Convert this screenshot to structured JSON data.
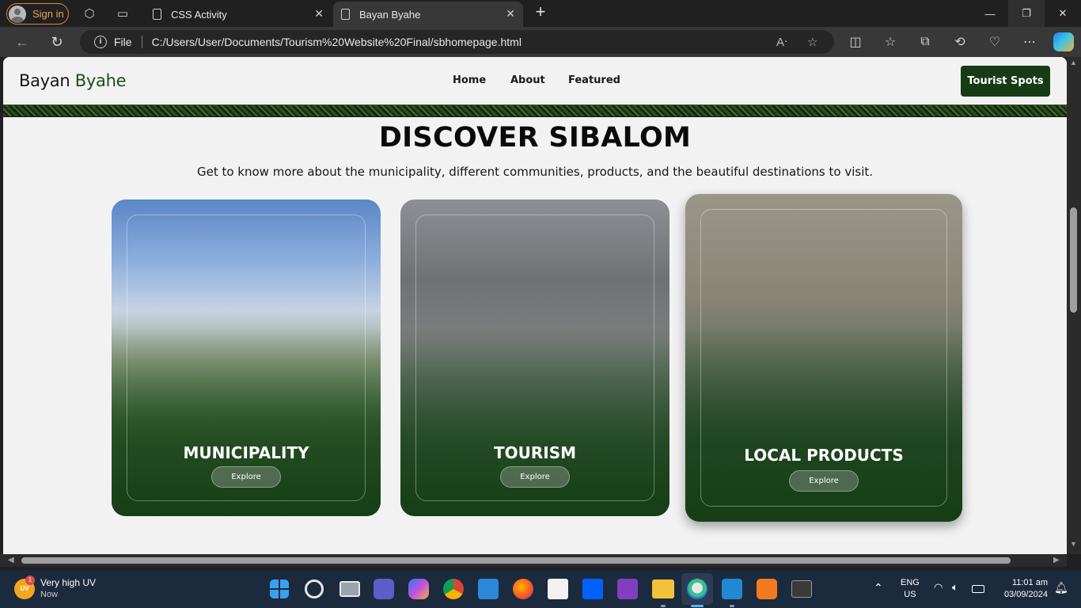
{
  "browser": {
    "signin_label": "Sign in",
    "tabs": [
      {
        "title": "CSS Activity"
      },
      {
        "title": "Bayan Byahe"
      }
    ],
    "address": {
      "scheme_label": "File",
      "url": "C:/Users/User/Documents/Tourism%20Website%20Final/sbhomepage.html"
    }
  },
  "site": {
    "logo": {
      "part1": "Bayan",
      "part2": "Byahe"
    },
    "nav": [
      "Home",
      "About",
      "Featured"
    ],
    "cta_label": "Tourist Spots",
    "accent_color": "#163b16",
    "heading": "DISCOVER SIBALOM",
    "subheading": "Get to know more about the municipality, different communities, products, and the beautiful destinations to visit.",
    "cards": [
      {
        "title": "MUNICIPALITY",
        "button": "Explore"
      },
      {
        "title": "TOURISM",
        "button": "Explore"
      },
      {
        "title": "LOCAL PRODUCTS",
        "button": "Explore"
      }
    ]
  },
  "taskbar": {
    "weather": {
      "badge": "1",
      "icon_text": "UV",
      "title": "Very high UV",
      "subtitle": "Now"
    },
    "language": {
      "line1": "ENG",
      "line2": "US"
    },
    "clock": {
      "time": "11:01 am",
      "date": "03/09/2024"
    },
    "apps": [
      "start-icon",
      "search-icon",
      "task-view-icon",
      "teams-icon",
      "copilot-icon",
      "chrome-icon",
      "store-icon",
      "firefox-icon",
      "amazon-icon",
      "dropbox-icon",
      "visual-studio-icon",
      "file-explorer-icon",
      "edge-icon",
      "vscode-icon",
      "xampp-icon",
      "terminal-icon"
    ]
  }
}
